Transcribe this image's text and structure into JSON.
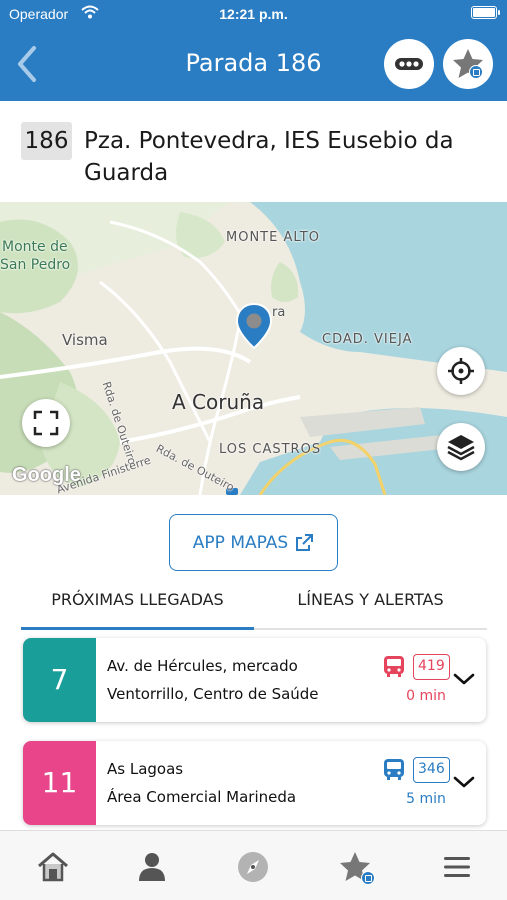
{
  "status_bar": {
    "carrier": "Operador",
    "time": "12:21 p.m."
  },
  "header": {
    "title": "Parada 186"
  },
  "stop": {
    "code": "186",
    "name": "Pza. Pontevedra, IES Eusebio da Guarda"
  },
  "map": {
    "labels": {
      "monte_alto": "MONTE ALTO",
      "monte_de": "Monte de",
      "san_pedro": "San Pedro",
      "visma": "Visma",
      "cdad_vieja": "CDAD. VIEJA",
      "coruna": "A Coruña",
      "los_castros": "LOS CASTROS",
      "rda_outeiro_1": "Rda. de Outeiro",
      "rda_outeiro_2": "Rda. de Outeiro",
      "finisterre": "Avenida Finisterre",
      "ra": "ra",
      "google": "Google"
    }
  },
  "app_maps": {
    "label": "APP MAPAS"
  },
  "tabs": [
    {
      "label": "PRÓXIMAS LLEGADAS",
      "active": true
    },
    {
      "label": "LÍNEAS Y ALERTAS",
      "active": false
    }
  ],
  "arrivals": [
    {
      "line": "7",
      "color": "#1a9e9a",
      "destination_1": "Av. de Hércules, mercado",
      "destination_2": "Ventorrillo, Centro de Saúde",
      "vehicle": "419",
      "eta": "0 min",
      "status_color": "#e5455c"
    },
    {
      "line": "11",
      "color": "#e8458a",
      "destination_1": "As Lagoas",
      "destination_2": "Área Comercial Marineda",
      "vehicle": "346",
      "eta": "5 min",
      "status_color": "#2a7dc3"
    }
  ],
  "bottom_nav": [
    "home-icon",
    "user-icon",
    "compass-icon",
    "favorites-icon",
    "menu-icon"
  ]
}
